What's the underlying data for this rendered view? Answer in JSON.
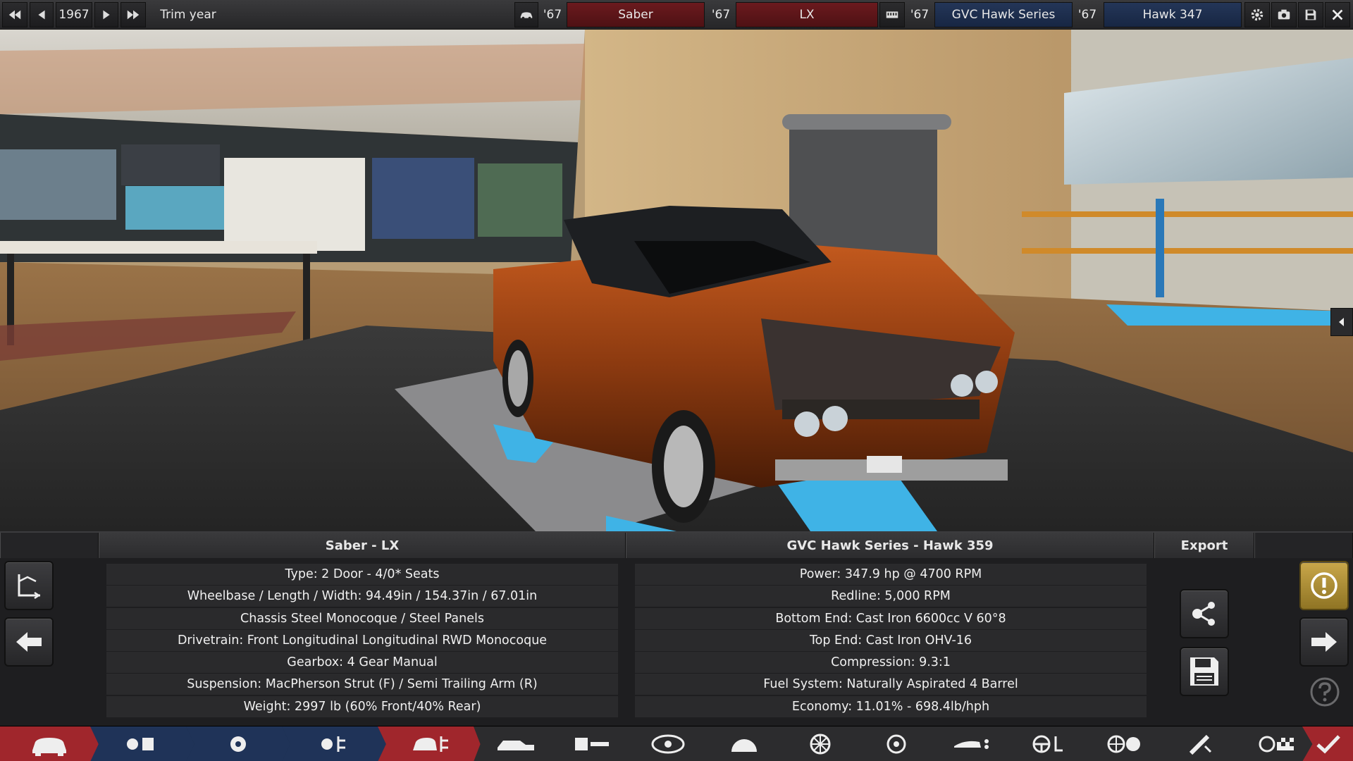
{
  "topbar": {
    "year": "1967",
    "trim_year_label": "Trim year",
    "model_year": "'67",
    "model_name": "Saber",
    "trim_year": "'67",
    "trim_name": "LX",
    "engine_year": "'67",
    "engine_family": "GVC Hawk Series",
    "variant_year": "'67",
    "variant_name": "Hawk 347"
  },
  "car_panel": {
    "title": "Saber - LX",
    "rows": [
      "Type: 2 Door - 4/0* Seats",
      "Wheelbase / Length / Width: 94.49in / 154.37in / 67.01in",
      "Chassis Steel Monocoque / Steel Panels",
      "Drivetrain: Front Longitudinal Longitudinal RWD Monocoque",
      "Gearbox: 4 Gear Manual",
      "Suspension: MacPherson Strut (F) / Semi Trailing Arm (R)",
      "Weight: 2997 lb (60% Front/40% Rear)"
    ]
  },
  "engine_panel": {
    "title": "GVC Hawk Series - Hawk 359",
    "rows": [
      "Power: 347.9 hp @ 4700 RPM",
      "Redline:  5,000 RPM",
      "Bottom End: Cast Iron 6600cc V 60°8",
      "Top End: Cast Iron OHV-16",
      "Compression: 9.3:1",
      "Fuel System: Naturally Aspirated 4 Barrel",
      "Economy: 11.01% - 698.4lb/hph"
    ]
  },
  "export_panel": {
    "title": "Export"
  },
  "colors": {
    "red_field": "#5c1519",
    "blue_field": "#1d2d4d",
    "warning_button": "#b8963a",
    "nav_active": "#a0262c",
    "nav_blue": "#1f3358"
  }
}
